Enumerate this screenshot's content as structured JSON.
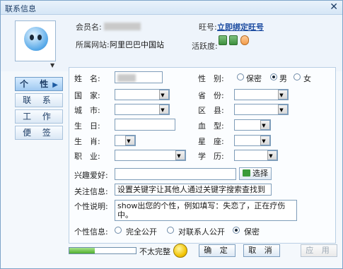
{
  "window": {
    "title": "联系信息"
  },
  "header": {
    "member_label": "会员名:",
    "site_label": "所属网站:",
    "site_value": "阿里巴巴中国站",
    "wangwang_label": "旺号:",
    "wangwang_link": "立即绑定旺号",
    "activity_label": "活跃度:"
  },
  "tabs": [
    "个 性",
    "联 系",
    "工 作",
    "便 签"
  ],
  "form": {
    "name_label": "姓　名:",
    "gender_label": "性　别:",
    "gender_options": [
      "保密",
      "男",
      "女"
    ],
    "gender_selected": "男",
    "country_label": "国　家:",
    "province_label": "省　份:",
    "city_label": "城　市:",
    "district_label": "区　县:",
    "birthday_label": "生　日:",
    "blood_label": "血　型:",
    "zodiac_label": "生　肖:",
    "constellation_label": "星　座:",
    "job_label": "职　业:",
    "education_label": "学　历:",
    "hobby_label": "兴趣爱好:",
    "choose_button": "选择",
    "focus_label": "关注信息:",
    "focus_value": "设置关键字让其他人通过关键字搜索查找到",
    "desc_label": "个性说明:",
    "desc_value": "show出您的个性，例如填写：失恋了，正在疗伤中。",
    "privacy_label": "个性信息:",
    "privacy_options": [
      "完全公开",
      "对联系人公开",
      "保密"
    ],
    "privacy_selected": "保密"
  },
  "footer": {
    "progress_label": "不太完整",
    "progress_fraction": 0.38,
    "ok": "确 定",
    "cancel": "取 消",
    "apply": "应 用"
  },
  "icons": {
    "close": "close-icon",
    "dropdown": "chevron-down-icon"
  }
}
